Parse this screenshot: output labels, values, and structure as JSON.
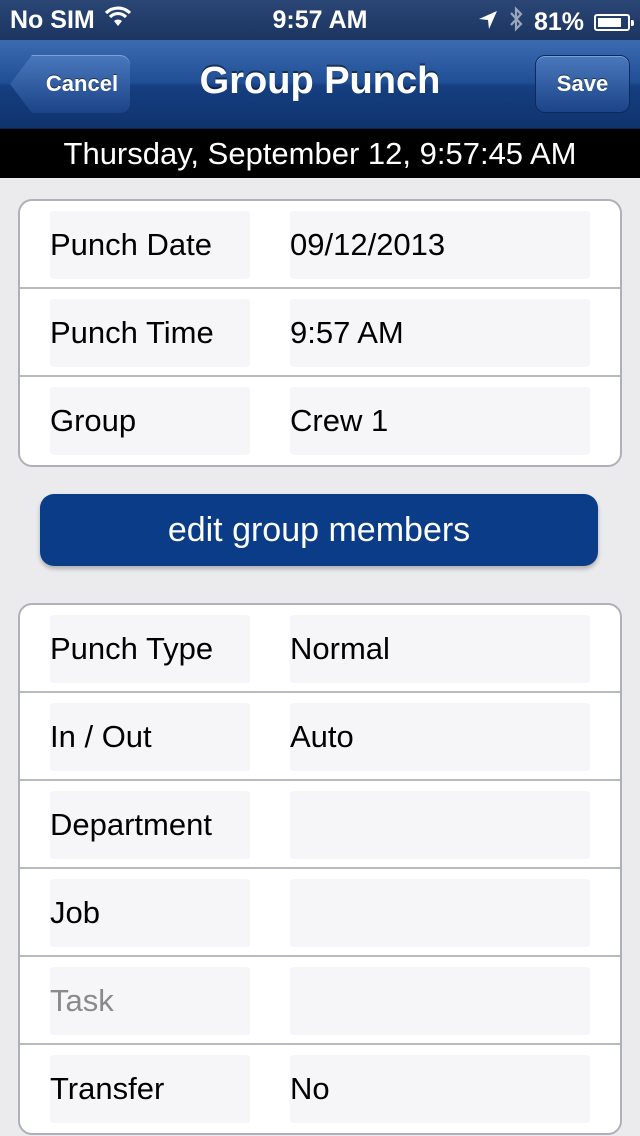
{
  "status_bar": {
    "carrier": "No SIM",
    "time": "9:57 AM",
    "battery_percent_label": "81%",
    "battery_level": 0.81,
    "icons": [
      "wifi-icon",
      "location-arrow-icon",
      "bluetooth-icon",
      "battery-icon"
    ]
  },
  "nav": {
    "title": "Group Punch",
    "cancel_label": "Cancel",
    "save_label": "Save"
  },
  "date_bar": {
    "text": "Thursday, September 12, 9:57:45 AM"
  },
  "punch_info": {
    "rows": [
      {
        "label": "Punch Date",
        "value": "09/12/2013"
      },
      {
        "label": "Punch Time",
        "value": "9:57 AM"
      },
      {
        "label": "Group",
        "value": "Crew 1"
      }
    ]
  },
  "actions": {
    "edit_group_members_label": "edit group members"
  },
  "punch_details": {
    "rows": [
      {
        "label": "Punch Type",
        "value": "Normal"
      },
      {
        "label": "In / Out",
        "value": "Auto"
      },
      {
        "label": "Department",
        "value": ""
      },
      {
        "label": "Job",
        "value": ""
      },
      {
        "label": "Task",
        "value": "",
        "disabled": true
      },
      {
        "label": "Transfer",
        "value": "No"
      }
    ]
  },
  "colors": {
    "nav_bar": "#1c4488",
    "action_button": "#0b3c87",
    "background": "#ebebed"
  }
}
